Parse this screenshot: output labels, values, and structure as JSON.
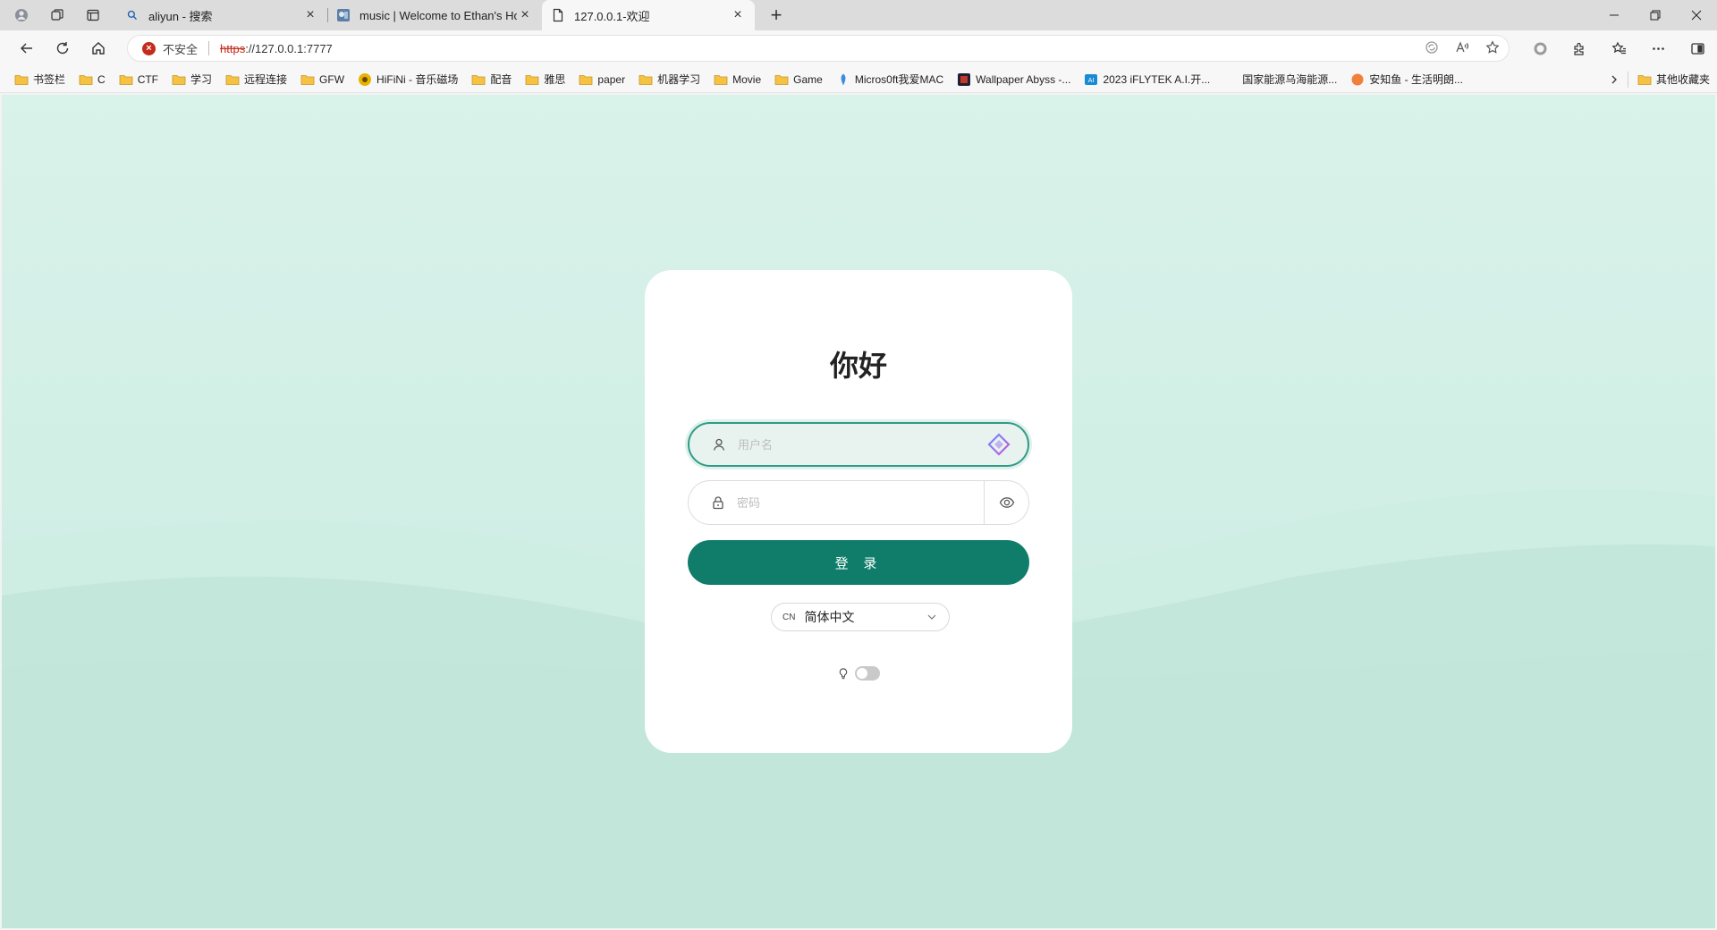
{
  "browser": {
    "tabs": [
      {
        "title": "aliyun - 搜索",
        "favicon": "search-icon",
        "active": false
      },
      {
        "title": "music | Welcome to Ethan's Home",
        "favicon": "site-favicon",
        "active": false
      },
      {
        "title": "127.0.0.1-欢迎",
        "favicon": "page-icon",
        "active": true
      }
    ],
    "address": {
      "security_label": "不安全",
      "scheme": "https",
      "host": "://127.0.0.1:7777"
    },
    "bookmarks": [
      {
        "label": "书签栏",
        "icon": "folder-icon"
      },
      {
        "label": "C",
        "icon": "folder-icon"
      },
      {
        "label": "CTF",
        "icon": "folder-icon"
      },
      {
        "label": "学习",
        "icon": "folder-icon"
      },
      {
        "label": "远程连接",
        "icon": "folder-icon"
      },
      {
        "label": "GFW",
        "icon": "folder-icon"
      },
      {
        "label": "HiFiNi - 音乐磁场",
        "icon": "hifini-icon"
      },
      {
        "label": "配音",
        "icon": "folder-icon"
      },
      {
        "label": "雅思",
        "icon": "folder-icon"
      },
      {
        "label": "paper",
        "icon": "folder-icon"
      },
      {
        "label": "机器学习",
        "icon": "folder-icon"
      },
      {
        "label": "Movie",
        "icon": "folder-icon"
      },
      {
        "label": "Game",
        "icon": "folder-icon"
      },
      {
        "label": "Micros0ft我爱MAC",
        "icon": "site-icon"
      },
      {
        "label": "Wallpaper Abyss -...",
        "icon": "wallpaper-icon"
      },
      {
        "label": "2023 iFLYTEK A.I.开...",
        "icon": "iflytek-icon"
      },
      {
        "label": "国家能源乌海能源...",
        "icon": "energy-icon"
      },
      {
        "label": "安知鱼 - 生活明朗...",
        "icon": "fish-icon"
      }
    ],
    "other_bookmarks": "其他收藏夹"
  },
  "login": {
    "greeting": "你好",
    "username_placeholder": "用户名",
    "password_placeholder": "密码",
    "submit_label": "登 录",
    "language_code": "CN",
    "language_value": "简体中文",
    "dark_mode": false
  },
  "colors": {
    "primary": "#0f7d6a",
    "background": "#d4efe6",
    "insecure": "#c42b1c"
  }
}
